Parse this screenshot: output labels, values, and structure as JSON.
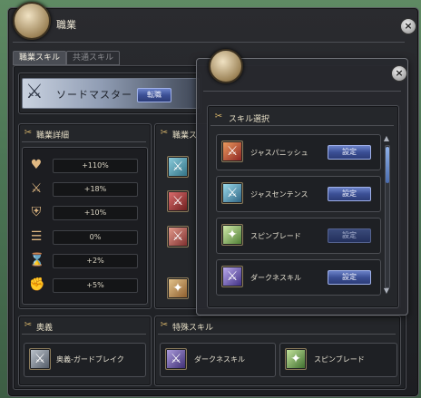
{
  "window": {
    "title": "職業"
  },
  "tabs": [
    {
      "label": "職業スキル",
      "active": true
    },
    {
      "label": "共通スキル",
      "active": false
    }
  ],
  "banner": {
    "class_name": "ソードマスター",
    "change_button": "転職"
  },
  "class_detail": {
    "title": "職業詳細",
    "stats": [
      {
        "icon": "heart-icon",
        "value": "+110%"
      },
      {
        "icon": "sword-icon",
        "value": "+18%"
      },
      {
        "icon": "shield-icon",
        "value": "+10%"
      },
      {
        "icon": "bars-icon",
        "value": "0%"
      },
      {
        "icon": "hourglass-icon",
        "value": "+2%"
      },
      {
        "icon": "fist-icon",
        "value": "+5%"
      }
    ]
  },
  "class_skills": {
    "title": "職業ス"
  },
  "ougi": {
    "title": "奥義",
    "skill_name": "奥義-ガードブレイク"
  },
  "special_skills": {
    "title": "特殊スキル",
    "items": [
      {
        "name": "ダークネスキル"
      },
      {
        "name": "スピンブレード"
      }
    ]
  },
  "skill_select": {
    "title": "スキル選択",
    "items": [
      {
        "name": "ジャスパニッシュ",
        "button": "設定",
        "button_state": "bright"
      },
      {
        "name": "ジャスセンテンス",
        "button": "設定",
        "button_state": "bright"
      },
      {
        "name": "スピンブレード",
        "button": "設定",
        "button_state": "dim"
      },
      {
        "name": "ダークネスキル",
        "button": "設定",
        "button_state": "bright"
      }
    ]
  },
  "colors": {
    "accent_blue": "#3b4f95",
    "gold": "#d6b46a"
  }
}
